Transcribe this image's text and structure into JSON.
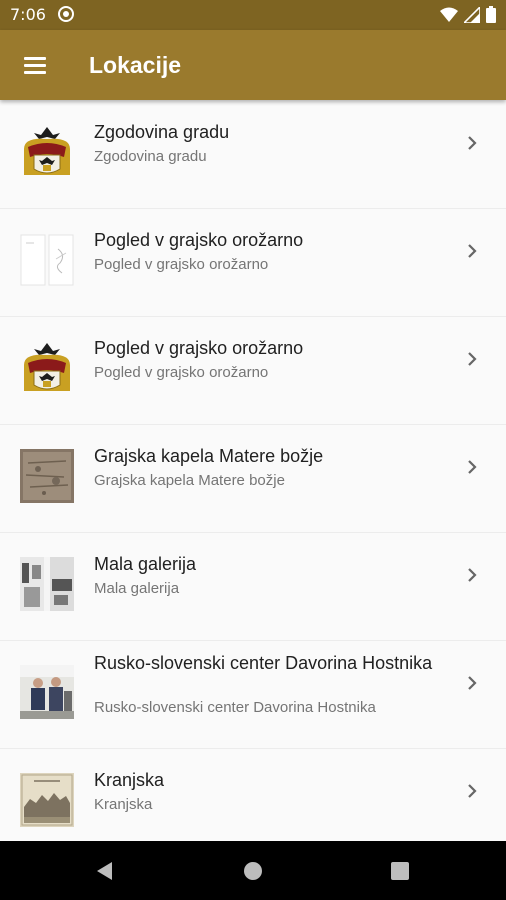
{
  "status": {
    "time": "7:06"
  },
  "app_bar": {
    "title": "Lokacije"
  },
  "locations": [
    {
      "title": "Zgodovina gradu",
      "subtitle": "Zgodovina gradu",
      "thumb": "coat-of-arms"
    },
    {
      "title": "Pogled v grajsko orožarno",
      "subtitle": "Pogled v grajsko orožarno",
      "thumb": "sketch"
    },
    {
      "title": "Pogled v grajsko orožarno",
      "subtitle": "Pogled v grajsko orožarno",
      "thumb": "coat-of-arms"
    },
    {
      "title": "Grajska kapela Matere božje",
      "subtitle": "Grajska kapela Matere božje",
      "thumb": "stone-photo"
    },
    {
      "title": "Mala galerija",
      "subtitle": "Mala galerija",
      "thumb": "gallery-photo"
    },
    {
      "title": "Rusko-slovenski center Davorina Hostnika",
      "subtitle": "Rusko-slovenski center Davorina Hostnika",
      "thumb": "people-photo"
    },
    {
      "title": "Kranjska",
      "subtitle": "Kranjska",
      "thumb": "engraving"
    }
  ],
  "colors": {
    "status_bar": "#7e6422",
    "app_bar": "#9a7a2d",
    "background": "#fafafa"
  }
}
